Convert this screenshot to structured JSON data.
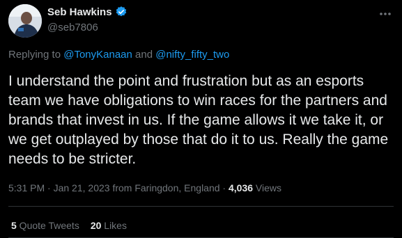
{
  "author": {
    "display_name": "Seb Hawkins",
    "handle": "@seb7806",
    "verified": true
  },
  "reply": {
    "prefix": "Replying to ",
    "mention_1": "@TonyKanaan",
    "and": " and ",
    "mention_2": "@nifty_fifty_two"
  },
  "tweet": {
    "text": "I understand the point and frustration but as an esports team we have obligations to win races for the partners and brands that invest in us. If the game allows it we take it, or we get outplayed by those that do it to us. Really the game needs to be stricter."
  },
  "meta": {
    "time": "5:31 PM",
    "sep1": " · ",
    "date": "Jan 21, 2023",
    "location": " from Faringdon, England",
    "sep2": " · ",
    "views_count": "4,036",
    "views_label": " Views"
  },
  "stats": {
    "quote_tweets_count": "5",
    "quote_tweets_label": " Quote Tweets",
    "likes_count": "20",
    "likes_label": " Likes"
  },
  "colors": {
    "background": "#000000",
    "text": "#e7e9ea",
    "secondary": "#71767b",
    "accent": "#1d9bf0",
    "divider": "#2f3336"
  },
  "icons": [
    "avatar",
    "verified-badge-icon",
    "more-options-icon"
  ]
}
